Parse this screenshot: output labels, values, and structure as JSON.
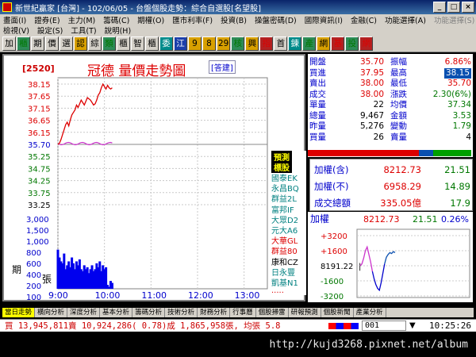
{
  "window": {
    "title": "新世紀贏家 [台灣] - 102/06/05 - 台盤個股走勢：綜合自選股[名望股]",
    "controls": [
      "_",
      "□",
      "×"
    ]
  },
  "menu1": [
    "畫面(I)",
    "證券(E)",
    "主力(M)",
    "籌碼(C)",
    "期權(O)",
    "匯市利率(F)",
    "投資(B)",
    "操盤密碼(D)",
    "國際資訊(I)",
    "金融(C)",
    "功能選擇(A)",
    "功能選擇(S)"
  ],
  "menu2": [
    "檢視(V)",
    "設定(S)",
    "工具(T)",
    "說明(H)"
  ],
  "toolbar": [
    "加",
    "櫃",
    "期",
    "價",
    "選",
    "認",
    "綜",
    "類",
    "櫃",
    "智",
    "櫃",
    "委",
    "江",
    "9",
    "8",
    "29",
    "核",
    "興",
    "指",
    "首",
    "鍊",
    "產",
    "網",
    "基",
    "投",
    "網"
  ],
  "stock": {
    "code": "[2520]",
    "title": "冠德  量價走勢圖",
    "note": "[答建]"
  },
  "quote": [
    {
      "l1": "開盤",
      "v1": "35.70",
      "l2": "振幅",
      "v2": "6.86%",
      "c1": "red",
      "c2": "red"
    },
    {
      "l1": "買進",
      "v1": "37.95",
      "l2": "最高",
      "v2": "38.15",
      "c1": "red",
      "c2": "hl"
    },
    {
      "l1": "賣出",
      "v1": "38.00",
      "l2": "最低",
      "v2": "35.70",
      "c1": "red",
      "c2": "red"
    },
    {
      "l1": "成交",
      "v1": "38.00",
      "l2": "漲跌",
      "v2": "2.30(6%)",
      "c1": "red",
      "c2": "green"
    },
    {
      "l1": "單量",
      "v1": "22",
      "l2": "均價",
      "v2": "37.34",
      "c1": "",
      "c2": "green"
    },
    {
      "l1": "總量",
      "v1": "9,467",
      "l2": "金額",
      "v2": "3.53",
      "c1": "",
      "c2": "green"
    },
    {
      "l1": "昨量",
      "v1": "5,276",
      "l2": "變動",
      "v2": "1.79",
      "c1": "",
      "c2": "green"
    },
    {
      "l1": "買量",
      "v1": "26",
      "l2": "賣量",
      "v2": "4",
      "c1": "",
      "c2": ""
    }
  ],
  "index": [
    {
      "label": "加權(含)",
      "val": "8212.73",
      "chg": "21.51"
    },
    {
      "label": "加權(不)",
      "val": "6958.29",
      "chg": "14.89"
    },
    {
      "label": "成交總額",
      "val": "335.05億",
      "chg": "17.9"
    }
  ],
  "tags": {
    "header1": "預測",
    "header2": "標股",
    "items": [
      "國泰EK",
      "永昌BQ",
      "群益2L",
      "富邦IF",
      "大眾D2",
      "元大A6",
      "大華GL",
      "群益80",
      "康和CZ",
      "日永豐",
      "凱基N1",
      "....."
    ]
  },
  "chart_data": [
    {
      "type": "line",
      "y_price_ticks": [
        "38.15",
        "37.65",
        "37.15",
        "36.65",
        "36.15",
        "35.70",
        "35.25",
        "34.75",
        "34.25",
        "33.75",
        "33.25"
      ],
      "y_volume_ticks": [
        "3,000",
        "1,500",
        "1,000",
        "800",
        "600",
        "400",
        "200",
        "100",
        "50",
        "35",
        "15"
      ],
      "volume_side_labels": [
        "期",
        "張"
      ],
      "x_ticks": [
        "9:00",
        "10:00",
        "11:00",
        "12:00",
        "13:00"
      ],
      "x_time_min": [
        0,
        60,
        120,
        180,
        240
      ],
      "ylim": [
        33.25,
        38.15
      ],
      "ref_price": 35.7,
      "price_series": {
        "x_min": [
          0,
          2,
          4,
          6,
          8,
          10,
          12,
          14,
          16,
          18,
          20,
          22,
          24,
          26,
          28,
          30,
          32,
          34,
          36,
          38,
          40,
          42,
          44,
          46,
          48,
          50,
          52,
          54,
          56,
          58,
          60,
          62,
          64,
          66,
          68,
          70
        ],
        "y": [
          35.7,
          35.75,
          35.9,
          36.1,
          36.3,
          36.5,
          36.6,
          36.45,
          36.7,
          36.9,
          37.0,
          37.1,
          37.3,
          37.2,
          37.35,
          37.5,
          37.4,
          37.3,
          37.45,
          37.6,
          37.55,
          37.5,
          37.4,
          37.3,
          37.35,
          37.5,
          37.7,
          37.8,
          38.0,
          38.15,
          38.05,
          37.95,
          38.1,
          38.0,
          37.95,
          38.0
        ]
      },
      "volume_series": {
        "x_min": [
          0,
          2,
          4,
          6,
          8,
          10,
          12,
          14,
          16,
          18,
          20,
          22,
          24,
          26,
          28,
          30,
          32,
          34,
          36,
          38,
          40,
          42,
          44,
          46,
          48,
          50,
          52,
          54,
          56,
          58,
          60,
          62,
          64,
          66,
          68,
          70
        ],
        "values": [
          1000,
          800,
          700,
          650,
          900,
          500,
          600,
          700,
          550,
          800,
          650,
          500,
          700,
          600,
          750,
          500,
          450,
          600,
          500,
          550,
          400,
          500,
          600,
          450,
          500,
          650,
          550,
          700,
          450,
          600,
          500,
          550,
          100,
          50,
          200,
          150
        ]
      }
    },
    {
      "type": "line",
      "title_label": "加權",
      "title_value": "8212.73",
      "title_chg": "21.51",
      "title_pct": "0.26%",
      "y_ticks": [
        "+3200",
        "+1600",
        "8191.22",
        "-1600",
        "-3200"
      ],
      "left_mark": "|",
      "series": {
        "x": [
          0,
          1,
          2,
          3,
          4,
          5,
          6,
          7,
          8,
          9,
          10,
          11,
          12,
          13,
          14,
          15,
          16,
          17,
          18,
          19,
          20
        ],
        "y": [
          0,
          200,
          800,
          1600,
          2000,
          1200,
          400,
          -600,
          -1400,
          -2000,
          -2400,
          -2600,
          -1800,
          -800,
          200,
          900,
          1200,
          1400,
          1300,
          1500,
          1400
        ]
      }
    }
  ],
  "tabs": [
    "當日走勢",
    "橫向分析",
    "深度分析",
    "基本分析",
    "籌碼分析",
    "技術分析",
    "財務分析",
    "行事曆",
    "個股掃雷",
    "研報預測",
    "個股新聞",
    "產業分析"
  ],
  "active_tab": "當日走勢",
  "status": {
    "text": "買 13,945,811賣 10,924,286( 0.78)成 1,865,958張, 均張 5.8",
    "code": "001",
    "arrow": "▼",
    "time": "10:25:26"
  },
  "watermark": "http://kujd3268.pixnet.net/album"
}
